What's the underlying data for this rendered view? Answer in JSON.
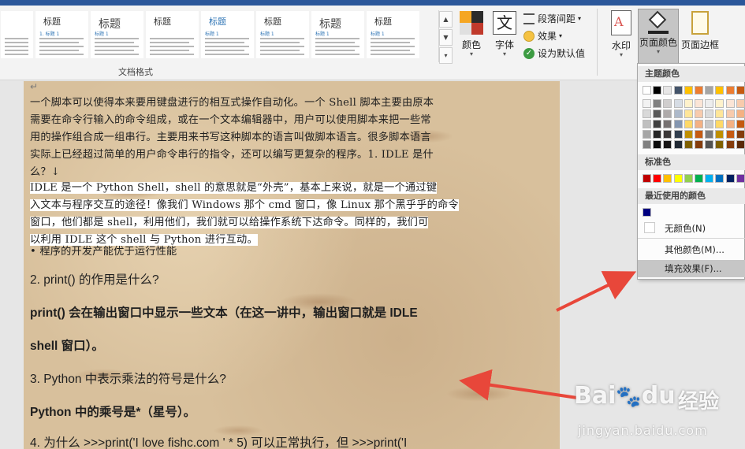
{
  "ribbon": {
    "style_gallery": [
      {
        "title": "",
        "sub": ""
      },
      {
        "title": "标题",
        "sub": "1. 标题 1"
      },
      {
        "title": "标题",
        "sub": "标题 1"
      },
      {
        "title": "标题",
        "sub": ""
      },
      {
        "title": "标题",
        "sub": "标题 1"
      },
      {
        "title": "标题",
        "sub": "标题 1"
      },
      {
        "title": "标题",
        "sub": "标题 1"
      },
      {
        "title": "标题",
        "sub": "标题 1"
      }
    ],
    "group_label": "文档格式",
    "colors_label": "颜色",
    "fonts_label": "字体",
    "paragraph_spacing_label": "段落间距",
    "effects_label": "效果",
    "set_default_label": "设为默认值",
    "watermark_label": "水印",
    "page_color_label": "页面颜色",
    "page_borders_label": "页面边框"
  },
  "document": {
    "para1_lines": [
      "一个脚本可以使得本来要用键盘进行的相互式操作自动化。一个 Shell 脚本主要由原本",
      "需要在命令行输入的命令组成，或在一个文本编辑器中，用户可以使用脚本来把一些常",
      "用的操作组合成一组串行。主要用来书写这种脚本的语言叫做脚本语言。很多脚本语言",
      "实际上已经超过简单的用户命令串行的指令，还可以编写更复杂的程序。1. IDLE 是什",
      "么？↓"
    ],
    "para2_lines": [
      "IDLE 是一个 Python Shell，shell 的意思就是“外壳”，基本上来说，就是一个通过键",
      "入文本与程序交互的途径！像我们 Windows 那个 cmd 窗口，像 Linux 那个黑乎乎的命令",
      "窗口，他们都是 shell，利用他们，我们就可以给操作系统下达命令。同样的，我们可",
      "以利用 IDLE 这个 shell 与 Python 进行互动。"
    ],
    "bullet": "•     程序的开发产能优于运行性能",
    "q2": "2. print()  的作用是什么?",
    "a2_line1": "print()  会在输出窗口中显示一些文本（在这一讲中，输出窗口就是 IDLE",
    "a2_line2": "shell 窗口）。",
    "q3": "3. Python  中表示乘法的符号是什么?",
    "a3": "Python 中的乘号是*（星号）。",
    "q4": "4. 为什么 >>>print('I love fishc.com ' * 5)  可以正常执行，但 >>>print('I"
  },
  "page_color_menu": {
    "theme_colors_header": "主题颜色",
    "theme_colors_top": [
      "#ffffff",
      "#000000",
      "#e7e6e6",
      "#44546a",
      "#ffc000",
      "#ed7d31",
      "#a5a5a5",
      "#ffc000",
      "#ed7d31",
      "#c55a11"
    ],
    "theme_color_shade_columns": [
      [
        "#f2f2f2",
        "#d9d9d9",
        "#bfbfbf",
        "#a6a6a6",
        "#808080"
      ],
      [
        "#808080",
        "#595959",
        "#404040",
        "#262626",
        "#0d0d0d"
      ],
      [
        "#d0cece",
        "#aeaaaa",
        "#767171",
        "#3b3838",
        "#171616"
      ],
      [
        "#d6dce4",
        "#adb9ca",
        "#8496b0",
        "#323f4f",
        "#222a35"
      ],
      [
        "#fff2cc",
        "#ffe699",
        "#ffd966",
        "#bf8f00",
        "#7f6000"
      ],
      [
        "#fbe5d6",
        "#f8cbad",
        "#f4b183",
        "#c55a11",
        "#843c0c"
      ],
      [
        "#ededed",
        "#dbdbdb",
        "#c9c9c9",
        "#7b7b7b",
        "#525252"
      ],
      [
        "#fff2cc",
        "#ffe699",
        "#ffd966",
        "#bf8f00",
        "#7f6000"
      ],
      [
        "#fbe5d6",
        "#f8cbad",
        "#f4b183",
        "#c55a11",
        "#843c0c"
      ],
      [
        "#f8cbad",
        "#f4b183",
        "#c55a11",
        "#843c0c",
        "#5a2908"
      ]
    ],
    "standard_colors_header": "标准色",
    "standard_colors": [
      "#c00000",
      "#ff0000",
      "#ffc000",
      "#ffff00",
      "#92d050",
      "#00b050",
      "#00b0f0",
      "#0070c0",
      "#002060",
      "#7030a0"
    ],
    "recent_colors_header": "最近使用的颜色",
    "recent_colors": [
      "#000080"
    ],
    "no_color_label": "无颜色(N)",
    "more_colors_label": "其他颜色(M)...",
    "fill_effects_label": "填充效果(F)..."
  },
  "watermark": {
    "logo_text": "Bai",
    "logo_suffix": "du",
    "site_cn": "经验",
    "url": "jingyan.baidu.com"
  },
  "colors": {
    "ribbon_top": "#2b579a",
    "arrow": "#e8473a"
  }
}
